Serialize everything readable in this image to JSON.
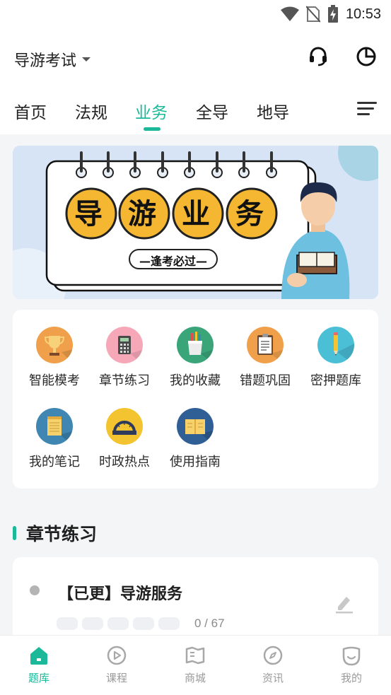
{
  "status_bar": {
    "time": "10:53",
    "icons": [
      "wifi-icon",
      "no-sim-icon",
      "battery-charging-icon"
    ]
  },
  "header": {
    "exam_selector": "导游考试",
    "icons": [
      "headset-icon",
      "pie-chart-icon"
    ]
  },
  "tabs": [
    {
      "label": "首页",
      "active": false
    },
    {
      "label": "法规",
      "active": false
    },
    {
      "label": "业务",
      "active": true
    },
    {
      "label": "全导",
      "active": false
    },
    {
      "label": "地导",
      "active": false
    }
  ],
  "banner": {
    "title_chars": [
      "导",
      "游",
      "业",
      "务"
    ],
    "subtitle": "—逢考必过—"
  },
  "features": [
    {
      "label": "智能模考",
      "icon": "trophy-icon",
      "color": "#f0a04b"
    },
    {
      "label": "章节练习",
      "icon": "calculator-icon",
      "color": "#f7a8b8"
    },
    {
      "label": "我的收藏",
      "icon": "pen-holder-icon",
      "color": "#3ba57a"
    },
    {
      "label": "错题巩固",
      "icon": "clipboard-icon",
      "color": "#f0a04b"
    },
    {
      "label": "密押题库",
      "icon": "pencil-icon",
      "color": "#4bbfd6"
    },
    {
      "label": "我的笔记",
      "icon": "notepad-icon",
      "color": "#3f86b3"
    },
    {
      "label": "时政热点",
      "icon": "protractor-icon",
      "color": "#f4c430"
    },
    {
      "label": "使用指南",
      "icon": "book-icon",
      "color": "#2f5f94"
    }
  ],
  "section": {
    "title": "章节练习"
  },
  "chapter": {
    "title": "【已更】导游服务",
    "progress_text": "0 / 67"
  },
  "bottom_nav": [
    {
      "label": "题库",
      "icon": "home-icon",
      "active": true
    },
    {
      "label": "课程",
      "icon": "play-icon",
      "active": false
    },
    {
      "label": "商城",
      "icon": "store-icon",
      "active": false
    },
    {
      "label": "资讯",
      "icon": "compass-icon",
      "active": false
    },
    {
      "label": "我的",
      "icon": "smile-icon",
      "active": false
    }
  ],
  "colors": {
    "accent": "#1bb99a",
    "background": "#f4f5f7"
  }
}
